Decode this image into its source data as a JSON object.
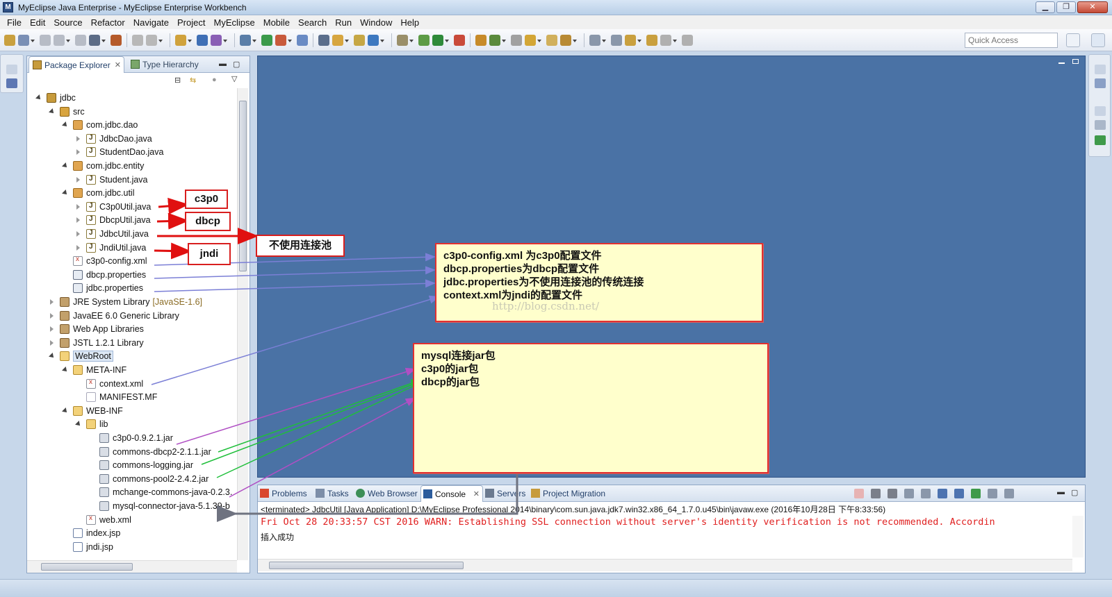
{
  "window": {
    "title": "MyEclipse Java Enterprise - MyEclipse Enterprise Workbench",
    "minimize": "▁",
    "restore": "❐",
    "close": "✕"
  },
  "menu": [
    "File",
    "Edit",
    "Source",
    "Refactor",
    "Navigate",
    "Project",
    "MyEclipse",
    "Mobile",
    "Search",
    "Run",
    "Window",
    "Help"
  ],
  "toolbar": {
    "quick_access_placeholder": "Quick Access"
  },
  "package_explorer": {
    "tab_active": "Package Explorer",
    "tab_inactive": "Type Hierarchy",
    "tree": [
      {
        "label": "jdbc",
        "indent": 0,
        "twisty": "open",
        "icon": "project"
      },
      {
        "label": "src",
        "indent": 1,
        "twisty": "open",
        "icon": "src"
      },
      {
        "label": "com.jdbc.dao",
        "indent": 2,
        "twisty": "open",
        "icon": "pkg"
      },
      {
        "label": "JdbcDao.java",
        "indent": 3,
        "twisty": "closed",
        "icon": "java"
      },
      {
        "label": "StudentDao.java",
        "indent": 3,
        "twisty": "closed",
        "icon": "java"
      },
      {
        "label": "com.jdbc.entity",
        "indent": 2,
        "twisty": "open",
        "icon": "pkg"
      },
      {
        "label": "Student.java",
        "indent": 3,
        "twisty": "closed",
        "icon": "java"
      },
      {
        "label": "com.jdbc.util",
        "indent": 2,
        "twisty": "open",
        "icon": "pkg"
      },
      {
        "label": "C3p0Util.java",
        "indent": 3,
        "twisty": "closed",
        "icon": "java"
      },
      {
        "label": "DbcpUtil.java",
        "indent": 3,
        "twisty": "closed",
        "icon": "java"
      },
      {
        "label": "JdbcUtil.java",
        "indent": 3,
        "twisty": "closed",
        "icon": "java"
      },
      {
        "label": "JndiUtil.java",
        "indent": 3,
        "twisty": "closed",
        "icon": "java"
      },
      {
        "label": "c3p0-config.xml",
        "indent": 2,
        "twisty": "none",
        "icon": "xml"
      },
      {
        "label": "dbcp.properties",
        "indent": 2,
        "twisty": "none",
        "icon": "props"
      },
      {
        "label": "jdbc.properties",
        "indent": 2,
        "twisty": "none",
        "icon": "props"
      },
      {
        "label": "JRE System Library",
        "extra": "[JavaSE-1.6]",
        "indent": 1,
        "twisty": "closed",
        "icon": "lib"
      },
      {
        "label": "JavaEE 6.0 Generic Library",
        "indent": 1,
        "twisty": "closed",
        "icon": "lib"
      },
      {
        "label": "Web App Libraries",
        "indent": 1,
        "twisty": "closed",
        "icon": "lib"
      },
      {
        "label": "JSTL 1.2.1 Library",
        "indent": 1,
        "twisty": "closed",
        "icon": "lib"
      },
      {
        "label": "WebRoot",
        "indent": 1,
        "twisty": "open",
        "icon": "folder"
      },
      {
        "label": "META-INF",
        "indent": 2,
        "twisty": "open",
        "icon": "folder"
      },
      {
        "label": "context.xml",
        "indent": 3,
        "twisty": "none",
        "icon": "xml"
      },
      {
        "label": "MANIFEST.MF",
        "indent": 3,
        "twisty": "none",
        "icon": "mf"
      },
      {
        "label": "WEB-INF",
        "indent": 2,
        "twisty": "open",
        "icon": "folder"
      },
      {
        "label": "lib",
        "indent": 3,
        "twisty": "open",
        "icon": "folder"
      },
      {
        "label": "c3p0-0.9.2.1.jar",
        "indent": 4,
        "twisty": "none",
        "icon": "jar"
      },
      {
        "label": "commons-dbcp2-2.1.1.jar",
        "indent": 4,
        "twisty": "none",
        "icon": "jar"
      },
      {
        "label": "commons-logging.jar",
        "indent": 4,
        "twisty": "none",
        "icon": "jar"
      },
      {
        "label": "commons-pool2-2.4.2.jar",
        "indent": 4,
        "twisty": "none",
        "icon": "jar"
      },
      {
        "label": "mchange-commons-java-0.2.3.",
        "indent": 4,
        "twisty": "none",
        "icon": "jar"
      },
      {
        "label": "mysql-connector-java-5.1.39-b",
        "indent": 4,
        "twisty": "none",
        "icon": "jar"
      },
      {
        "label": "web.xml",
        "indent": 3,
        "twisty": "none",
        "icon": "xml"
      },
      {
        "label": "index.jsp",
        "indent": 2,
        "twisty": "none",
        "icon": "jsp"
      },
      {
        "label": "jndi.jsp",
        "indent": 2,
        "twisty": "none",
        "icon": "jsp"
      }
    ]
  },
  "console": {
    "tabs": [
      "Problems",
      "Tasks",
      "Web Browser",
      "Console",
      "Servers",
      "Project Migration"
    ],
    "status": "<terminated> JdbcUtil [Java Application] D:\\MyEclipse Professional 2014\\binary\\com.sun.java.jdk7.win32.x86_64_1.7.0.u45\\bin\\javaw.exe (2016年10月28日 下午8:33:56)",
    "warn_line": "Fri Oct 28 20:33:57 CST 2016 WARN: Establishing SSL connection without server's identity verification is not recommended. Accordin",
    "output_line": "插入成功"
  },
  "annotations": {
    "c3p0": "c3p0",
    "dbcp": "dbcp",
    "nopool": "不使用连接池",
    "jndi": "jndi",
    "config_note": [
      "c3p0-config.xml 为c3p0配置文件",
      "dbcp.properties为dbcp配置文件",
      "jdbc.properties为不使用连接池的传统连接",
      "context.xml为jndi的配置文件"
    ],
    "jar_note": [
      "mysql连接jar包",
      "c3p0的jar包",
      "dbcp的jar包"
    ],
    "watermark": "http://blog.csdn.net/"
  },
  "colors": {
    "editor_bg": "#4a72a5",
    "warn_text": "#e02020",
    "note_bg": "#ffffcc",
    "red_arrow": "#e01010",
    "blue_arrow": "#7b7fd6",
    "purple_arrow": "#b04fc4",
    "green_arrow": "#1fbf3a",
    "gray_arrow": "#6f7380"
  }
}
